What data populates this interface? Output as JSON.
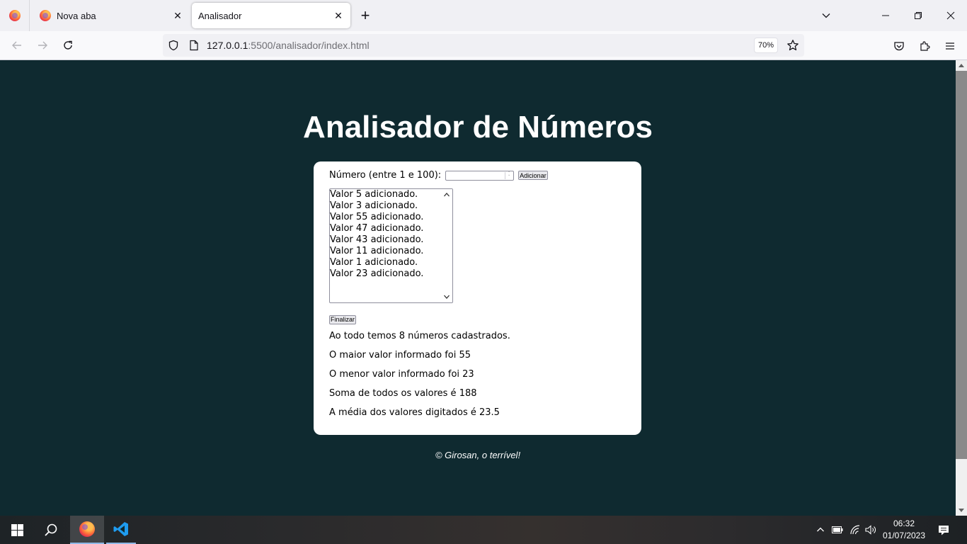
{
  "browser": {
    "tabs": [
      {
        "title": "Nova aba",
        "active": false
      },
      {
        "title": "Analisador",
        "active": true
      }
    ],
    "url_host": "127.0.0.1",
    "url_rest": ":5500/analisador/index.html",
    "zoom": "70%",
    "icons": [
      "firefox-icon",
      "close-icon",
      "plus-icon",
      "chevron-down-icon",
      "minimize-icon",
      "restore-icon",
      "back-icon",
      "forward-icon",
      "reload-icon",
      "shield-icon",
      "page-icon",
      "star-icon",
      "pocket-icon",
      "extensions-icon",
      "menu-icon"
    ]
  },
  "page": {
    "title": "Analisador de Números",
    "input_label": "Número (entre 1 e 100):",
    "input_value": "",
    "add_button": "Adicionar",
    "list_items": [
      "Valor 5 adicionado.",
      "Valor 3 adicionado.",
      "Valor 55 adicionado.",
      "Valor 47 adicionado.",
      "Valor 43 adicionado.",
      "Valor 11 adicionado.",
      "Valor 1 adicionado.",
      "Valor 23 adicionado."
    ],
    "finalize_button": "Finalizar",
    "results": [
      "Ao todo temos 8 números cadastrados.",
      "O maior valor informado foi 55",
      "O menor valor informado foi 23",
      "Soma de todos os valores é 188",
      "A média dos valores digitados é 23.5"
    ],
    "footer": "© Girosan, o terrível!",
    "colors": {
      "background": "#0f2a30",
      "card": "#ffffff",
      "title": "#ffffff"
    }
  },
  "taskbar": {
    "time": "06:32",
    "date": "01/07/2023",
    "icons": [
      "windows-start-icon",
      "search-icon",
      "firefox-icon",
      "vscode-icon",
      "chevron-up-icon",
      "battery-icon",
      "wifi-icon",
      "volume-icon",
      "notification-icon"
    ]
  }
}
